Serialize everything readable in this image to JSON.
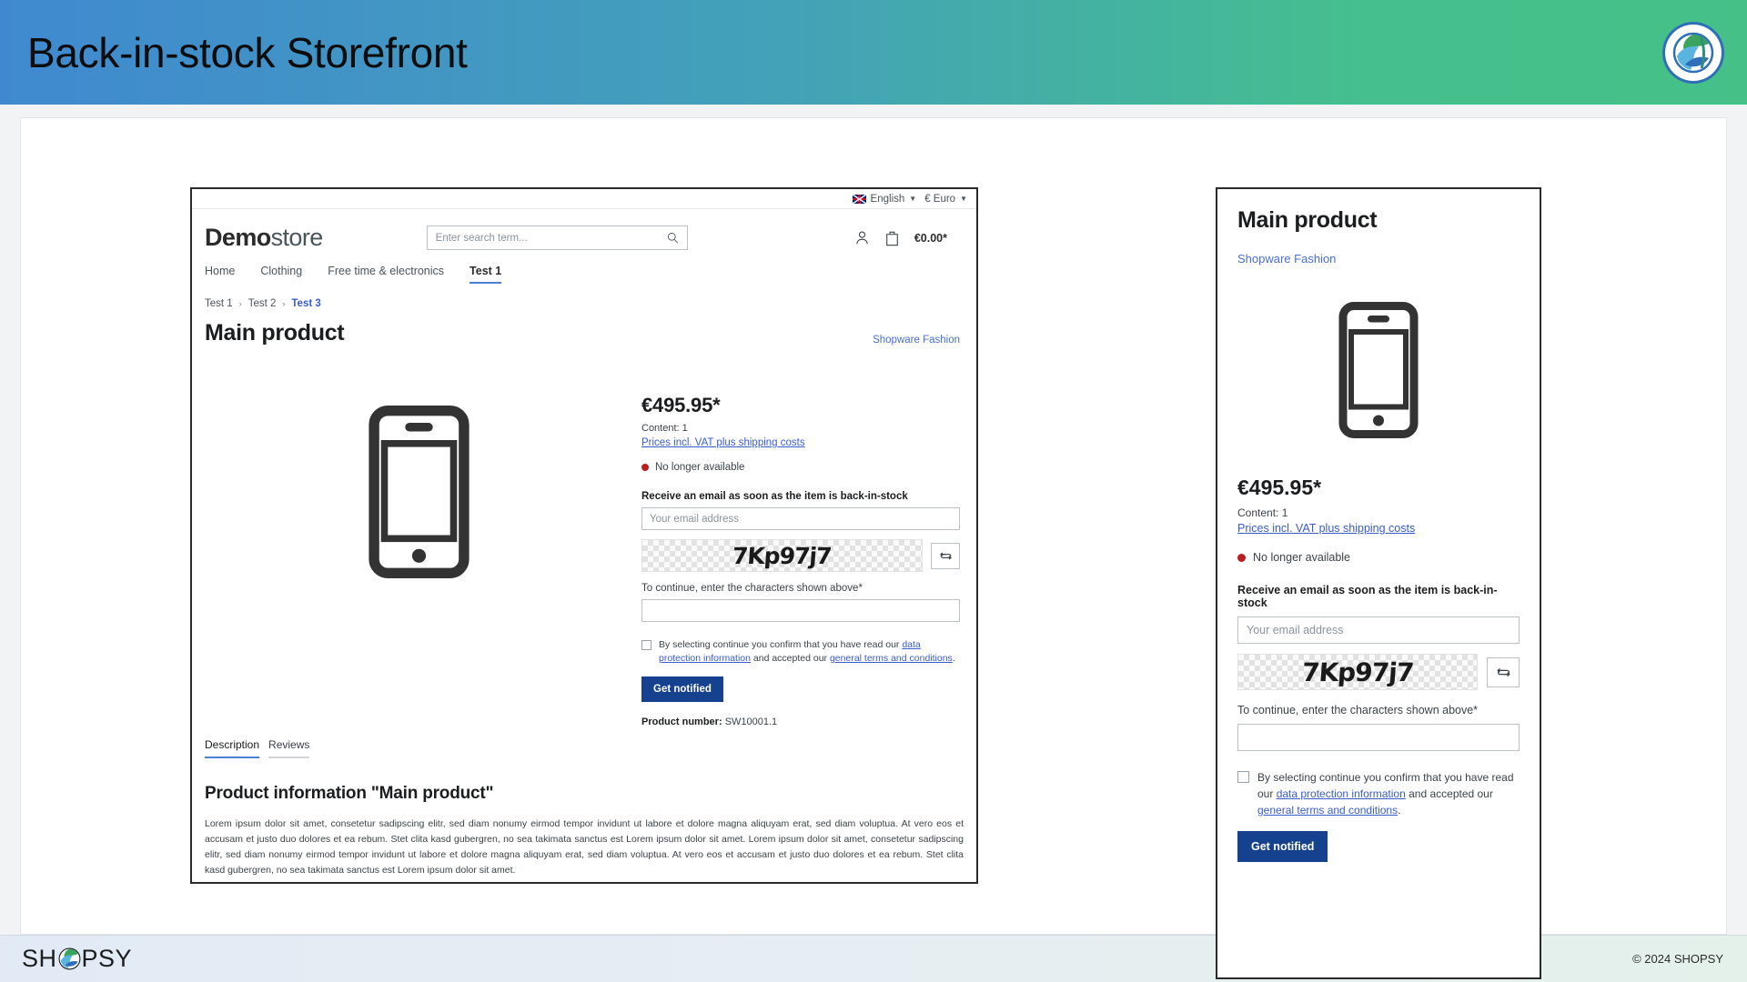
{
  "banner": {
    "title": "Back-in-stock Storefront",
    "logo_icon": "shopsy-circle-logo"
  },
  "storefront": {
    "topbar": {
      "flag_icon": "uk-flag-icon",
      "language": "English",
      "currency": "€ Euro",
      "caret_icon": "caret-down-icon"
    },
    "logo": {
      "bold": "Demo",
      "light": "store"
    },
    "search": {
      "placeholder": "Enter search term...",
      "value": "",
      "icon": "search-icon"
    },
    "actions": {
      "account_icon": "user-account-icon",
      "cart_icon": "shopping-bag-icon",
      "cart_total": "€0.00*"
    },
    "nav": [
      {
        "label": "Home",
        "active": false
      },
      {
        "label": "Clothing",
        "active": false
      },
      {
        "label": "Free time & electronics",
        "active": false
      },
      {
        "label": "Test 1",
        "active": true
      }
    ],
    "breadcrumb": [
      {
        "label": "Test 1",
        "current": false
      },
      {
        "label": "Test 2",
        "current": false
      },
      {
        "label": "Test 3",
        "current": true
      }
    ],
    "separator": "›",
    "product": {
      "title": "Main product",
      "manufacturer": "Shopware Fashion",
      "image_icon": "smartphone-icon",
      "price": "€495.95*",
      "content": "Content: 1",
      "vat_link": "Prices incl. VAT plus shipping costs",
      "availability": "No longer available",
      "availability_color": "#bb1e1e",
      "product_number_label": "Product number:",
      "product_number": "SW10001.1"
    },
    "notify_form": {
      "heading": "Receive an email as soon as the item is back-in-stock",
      "email_placeholder": "Your email address",
      "email_value": "",
      "captcha_text": "7Kp97j7",
      "refresh_icon": "refresh-captcha-icon",
      "captcha_hint": "To continue, enter the characters shown above*",
      "captcha_value": "",
      "consent_pre": "By selecting continue you confirm that you have read our ",
      "consent_link1": "data protection information",
      "consent_mid": " and accepted our ",
      "consent_link2": "general terms and conditions",
      "consent_post": ".",
      "submit_label": "Get notified",
      "submit_color": "#15418e"
    },
    "tabs": [
      {
        "label": "Description",
        "active": true
      },
      {
        "label": "Reviews",
        "active": false
      }
    ],
    "description": {
      "title": "Product information \"Main product\"",
      "body": "Lorem ipsum dolor sit amet, consetetur sadipscing elitr, sed diam nonumy eirmod tempor invidunt ut labore et dolore magna aliquyam erat, sed diam voluptua. At vero eos et accusam et justo duo dolores et ea rebum. Stet clita kasd gubergren, no sea takimata sanctus est Lorem ipsum dolor sit amet. Lorem ipsum dolor sit amet, consetetur sadipscing elitr, sed diam nonumy eirmod tempor invidunt ut labore et dolore magna aliquyam erat, sed diam voluptua. At vero eos et accusam et justo duo dolores et ea rebum. Stet clita kasd gubergren, no sea takimata sanctus est Lorem ipsum dolor sit amet."
    }
  },
  "mobile_panel": {
    "title": "Main product",
    "manufacturer": "Shopware Fashion",
    "image_icon": "smartphone-icon",
    "price": "€495.95*",
    "content": "Content: 1",
    "vat_link": "Prices incl. VAT plus shipping costs",
    "availability": "No longer available",
    "form_heading": "Receive an email as soon as the item is back-in-stock",
    "email_placeholder": "Your email address",
    "email_value": "",
    "captcha_text": "7Kp97j7",
    "refresh_icon": "refresh-captcha-icon",
    "captcha_hint": "To continue, enter the characters shown above*",
    "captcha_value": "",
    "consent_pre": "By selecting continue you confirm that you have read our ",
    "consent_link1": "data protection information",
    "consent_mid": " and accepted our ",
    "consent_link2": "general terms and conditions",
    "consent_post": ".",
    "submit_label": "Get notified"
  },
  "footer": {
    "brand_left": "SH",
    "brand_right": "PSY",
    "logo_icon": "shopsy-circle-logo",
    "copyright": "© 2024 SHOPSY"
  }
}
